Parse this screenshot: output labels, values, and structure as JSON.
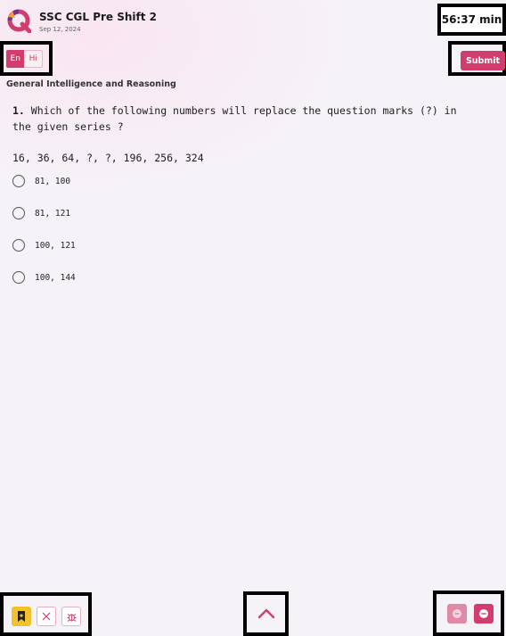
{
  "header": {
    "title": "SSC CGL Pre Shift 2",
    "date": "Sep 12, 2024",
    "timer": "56:37 min"
  },
  "language": {
    "en": "En",
    "hi": "Hi",
    "selected": "En"
  },
  "submit_label": "Submit",
  "section": "General Intelligence and Reasoning",
  "question": {
    "number": "1.",
    "text": "Which of the following numbers will replace the question marks (?) in the given series ?",
    "series": "16, 36, 64, ?, ?, 196, 256, 324",
    "options": [
      "81, 100",
      "81, 121",
      "100, 121",
      "100, 144"
    ]
  },
  "icons": {
    "logo": "logo-icon",
    "bookmark": "bookmark-icon",
    "clear": "close-icon",
    "report": "bug-icon",
    "scroll_up": "chevron-up-icon",
    "previous": "minus-circle-icon",
    "next": "next-circle-icon"
  },
  "colors": {
    "accent": "#d23d6e",
    "bookmark": "#f4c12e",
    "background": "#f5f3f8"
  }
}
